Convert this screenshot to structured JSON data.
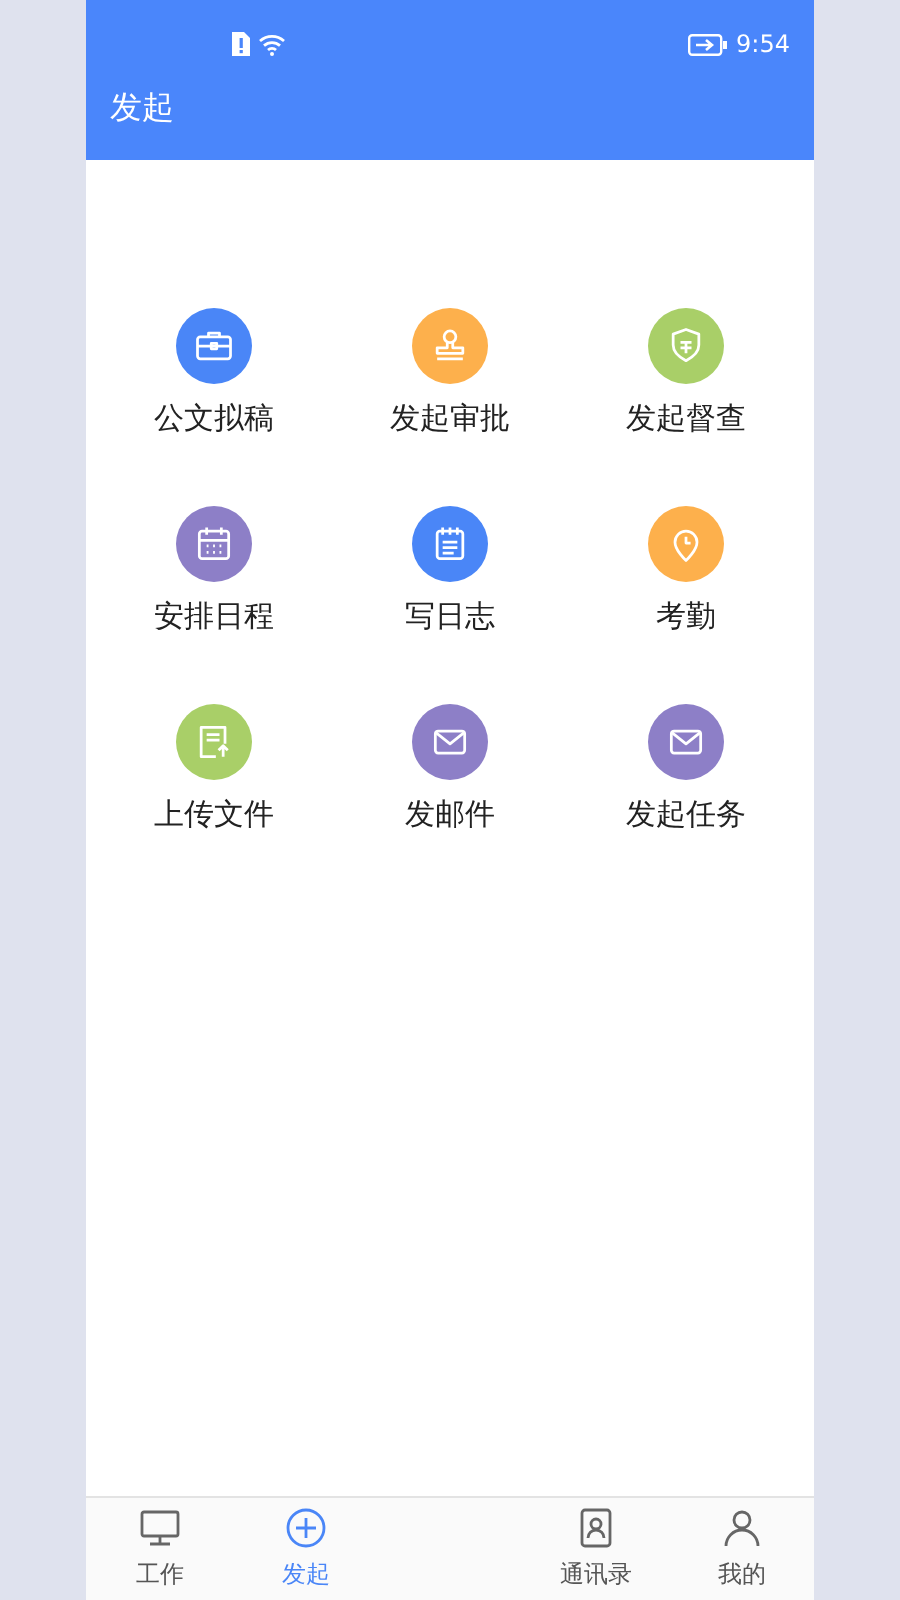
{
  "status_bar": {
    "time": "9:54"
  },
  "header": {
    "title": "发起"
  },
  "actions": [
    {
      "label": "公文拟稿",
      "color": "#4a86f7"
    },
    {
      "label": "发起审批",
      "color": "#fdb04c"
    },
    {
      "label": "发起督查",
      "color": "#a9cf68"
    },
    {
      "label": "安排日程",
      "color": "#8d7fc7"
    },
    {
      "label": "写日志",
      "color": "#4a86f7"
    },
    {
      "label": "考勤",
      "color": "#fdb04c"
    },
    {
      "label": "上传文件",
      "color": "#a9cf68"
    },
    {
      "label": "发邮件",
      "color": "#8d7fc7"
    },
    {
      "label": "发起任务",
      "color": "#8d7fc7"
    }
  ],
  "tabs": [
    {
      "label": "工作",
      "selected": false
    },
    {
      "label": "发起",
      "selected": true
    },
    {
      "label": "通讯录",
      "selected": false
    },
    {
      "label": "我的",
      "selected": false
    }
  ]
}
